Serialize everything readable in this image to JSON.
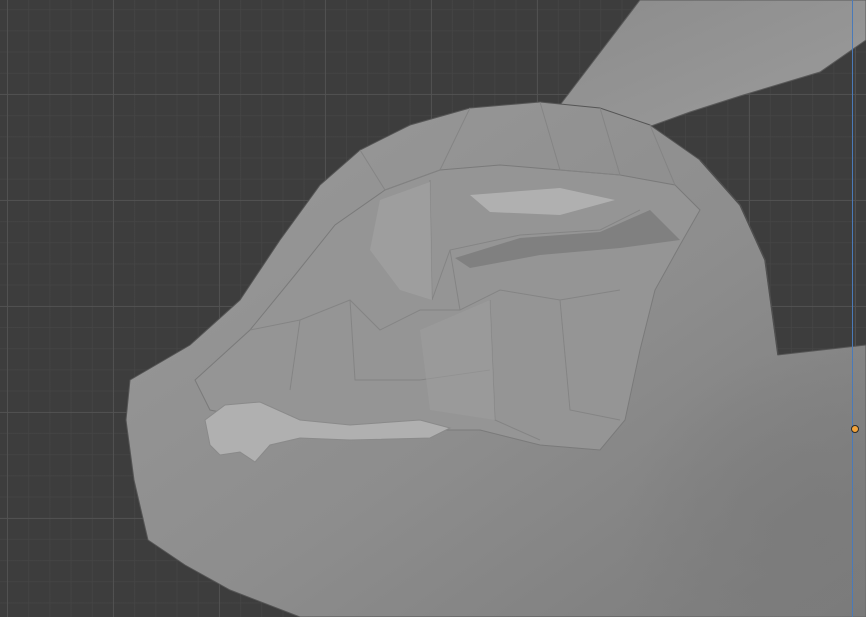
{
  "app": {
    "view": "3d-viewport",
    "object": "mesh",
    "shading": "solid"
  },
  "colors": {
    "background": "#3d3d3d",
    "grid_major": "#525252",
    "grid_minor": "#464646",
    "mesh_base": "#8e8e8e",
    "mesh_light": "#a6a6a6",
    "mesh_dark": "#6e6e6e",
    "edge_line": "#4a7ab8",
    "origin": "#f3a33a"
  },
  "icons": {
    "origin": "origin-dot-icon"
  }
}
